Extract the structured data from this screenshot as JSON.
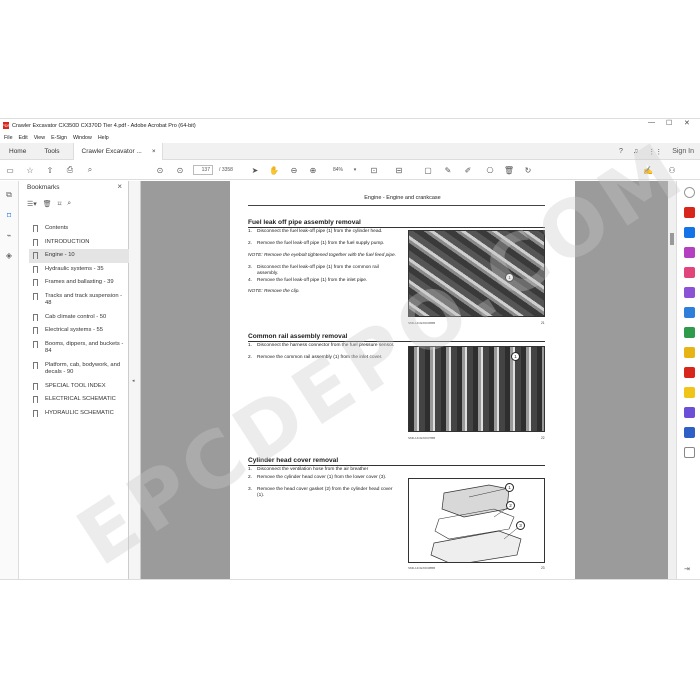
{
  "window": {
    "title": "Crawler Excavator CX350D CX370D Tier 4.pdf - Adobe Acrobat Pro (64-bit)",
    "pdf_badge": "PDF"
  },
  "menu": [
    "File",
    "Edit",
    "View",
    "E-Sign",
    "Window",
    "Help"
  ],
  "tabs": {
    "home": "Home",
    "tools": "Tools",
    "doc": "Crawler Excavator ...",
    "doc_close": "×",
    "sign_in": "Sign In"
  },
  "toolbar": {
    "page_current": "137",
    "page_total": "/ 3358",
    "zoom": "84%"
  },
  "bookmarks": {
    "heading": "Bookmarks",
    "close": "×",
    "items": [
      {
        "label": "Contents"
      },
      {
        "label": "INTRODUCTION"
      },
      {
        "label": "Engine - 10"
      },
      {
        "label": "Hydraulic systems - 35"
      },
      {
        "label": "Frames and ballasting - 39"
      },
      {
        "label": "Tracks and track suspension - 48"
      },
      {
        "label": "Cab climate control - 50"
      },
      {
        "label": "Electrical systems - 55"
      },
      {
        "label": "Booms, dippers, and buckets - 84"
      },
      {
        "label": "Platform, cab, bodywork, and decals - 90"
      },
      {
        "label": "SPECIAL TOOL INDEX"
      },
      {
        "label": "ELECTRICAL SCHEMATIC"
      },
      {
        "label": "HYDRAULIC SCHEMATIC"
      }
    ],
    "selected_index": 2
  },
  "page": {
    "header": "Engine - Engine and crankcase",
    "sections": [
      {
        "title": "Fuel leak off pipe assembly removal",
        "steps": [
          {
            "n": "1.",
            "text": "Disconnect the fuel leak-off pipe (1) from the cylinder head."
          },
          {
            "n": "2.",
            "text": "Remove the fuel leak-off pipe (1) from the fuel supply pump."
          },
          {
            "note": "NOTE: Remove the eyebolt tightened together with the fuel feed pipe."
          },
          {
            "n": "3.",
            "text": "Disconnect the fuel leak-off pipe (1) from the common rail assembly."
          },
          {
            "n": "4.",
            "text": "Remove the fuel leak-off pipe (1) from the inlet pipe."
          },
          {
            "note": "NOTE: Remove the clip."
          }
        ],
        "figure": {
          "caption": "SMIL14CEX0036BB",
          "number": "21",
          "callouts": [
            "1"
          ]
        }
      },
      {
        "title": "Common rail assembly removal",
        "steps": [
          {
            "n": "1.",
            "text": "Disconnect the harness connector from the fuel pressure sensor."
          },
          {
            "n": "2.",
            "text": "Remove the common rail assembly (1) from the inlet cover."
          }
        ],
        "figure": {
          "caption": "SMIL14CEX0037BB",
          "number": "22",
          "callouts": [
            "1"
          ]
        }
      },
      {
        "title": "Cylinder head cover removal",
        "steps": [
          {
            "n": "1.",
            "text": "Disconnect the ventilation hose from the air breather"
          },
          {
            "n": "2.",
            "text": "Remove the cylinder head cover (1) from the lower cover (3)."
          },
          {
            "n": "3.",
            "text": "Remove the head cover gasket (2) from the cylinder head cover (1)."
          }
        ],
        "figure": {
          "caption": "SMIL14CEX0038BB",
          "number": "23",
          "callouts": [
            "1",
            "2",
            "3"
          ]
        }
      }
    ]
  },
  "colors": {
    "accent": "#1473e6",
    "pdf_red": "#d9261c"
  },
  "watermark": "EPCDEPO.COM"
}
